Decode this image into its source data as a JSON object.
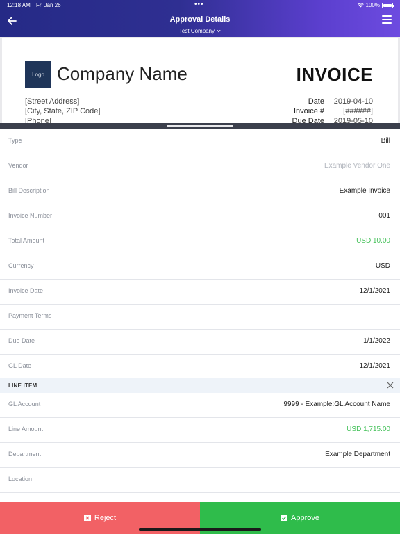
{
  "status_bar": {
    "time": "12:18 AM",
    "date": "Fri Jan 26",
    "battery": "100%",
    "battery_level": 1.0
  },
  "header": {
    "title": "Approval Details",
    "company": "Test Company"
  },
  "preview": {
    "logo": "Logo",
    "company_name": "Company Name",
    "invoice_title": "INVOICE",
    "address_lines": [
      "[Street Address]",
      "[City, State, ZIP Code]",
      "[Phone]"
    ],
    "meta": [
      {
        "label": "Date",
        "value": "2019-04-10"
      },
      {
        "label": "Invoice #",
        "value": "[######]"
      },
      {
        "label": "Due Date",
        "value": "2019-05-10"
      }
    ]
  },
  "fields": [
    {
      "label": "Type",
      "value": "Bill"
    },
    {
      "label": "Vendor",
      "value": "Example Vendor One"
    },
    {
      "label": "Bill Description",
      "value": "Example Invoice"
    },
    {
      "label": "Invoice Number",
      "value": "001"
    },
    {
      "label": "Total Amount",
      "value": "USD 10.00"
    },
    {
      "label": "Currency",
      "value": "USD"
    },
    {
      "label": "Invoice Date",
      "value": "12/1/2021"
    },
    {
      "label": "Payment Terms",
      "value": ""
    },
    {
      "label": "Due Date",
      "value": "1/1/2022"
    },
    {
      "label": "GL Date",
      "value": "12/1/2021"
    }
  ],
  "line_item": {
    "title": "LINE ITEM",
    "fields": [
      {
        "label": "GL Account",
        "value": "9999 - Example:GL Account Name"
      },
      {
        "label": "Line Amount",
        "value": "USD 1,715.00"
      },
      {
        "label": "Department",
        "value": "Example Department"
      },
      {
        "label": "Location",
        "value": ""
      }
    ]
  },
  "actions": {
    "reject": "Reject",
    "approve": "Approve"
  },
  "colors": {
    "reject": "#f26165",
    "approve": "#2fbc4b",
    "amount": "#44c159",
    "header_start": "#252a86",
    "header_end": "#6d4be0"
  }
}
